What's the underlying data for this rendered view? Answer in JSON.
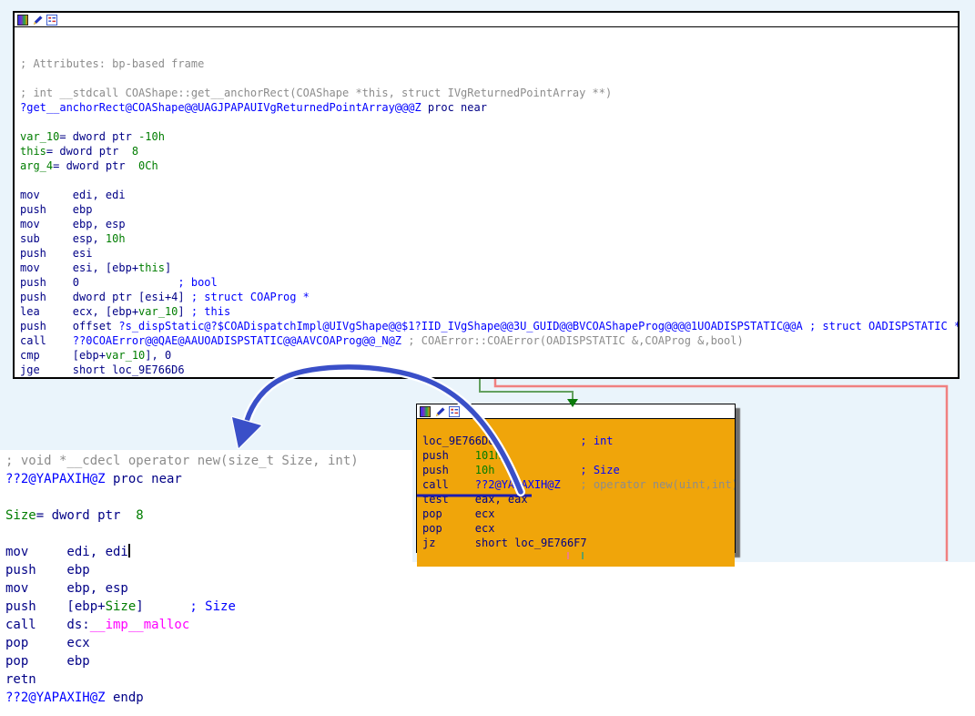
{
  "app": "IDA Pro graph view",
  "colors": {
    "background": "#eaf4fb",
    "node_bg": "#ffffff",
    "node_border": "#000000",
    "highlight_node_bg": "#f0a50a",
    "edge_true": "#63a05f",
    "edge_false": "#f08080",
    "edge_arrowhead": "#0a7a0a",
    "annotation_arrow": "#3a4fc8",
    "annotation_outline": "#ffffff",
    "call_underline": "#1c1cb0",
    "text_default": "#000086",
    "text_name": "#0000ff",
    "text_number": "#007d00",
    "text_comment": "#8c8c8c",
    "text_import": "#ff00ff"
  },
  "title_icons": [
    "palette-icon",
    "edit-icon",
    "graph-overview-icon"
  ],
  "blocks": {
    "main": {
      "lines": [
        [],
        [],
        [
          [
            "; Attributes: bp-based frame",
            "gry"
          ]
        ],
        [],
        [
          [
            "; int __stdcall COAShape::get__anchorRect(COAShape *this, struct IVgReturnedPointArray **)",
            "gry"
          ]
        ],
        [
          [
            "?get__anchorRect@COAShape@@UAGJPAPAUIVgReturnedPointArray@@@Z",
            "blu"
          ],
          [
            " proc near",
            "nav"
          ]
        ],
        [],
        [
          [
            "var_10",
            "grn"
          ],
          [
            "= dword ptr ",
            "nav"
          ],
          [
            "-10h",
            "grn"
          ]
        ],
        [
          [
            "this",
            "grn"
          ],
          [
            "= dword ptr  ",
            "nav"
          ],
          [
            "8",
            "grn"
          ]
        ],
        [
          [
            "arg_4",
            "grn"
          ],
          [
            "= dword ptr  ",
            "nav"
          ],
          [
            "0Ch",
            "grn"
          ]
        ],
        [],
        [
          [
            "mov     edi, edi",
            "nav"
          ]
        ],
        [
          [
            "push    ebp",
            "nav"
          ]
        ],
        [
          [
            "mov     ebp, esp",
            "nav"
          ]
        ],
        [
          [
            "sub     esp, ",
            "nav"
          ],
          [
            "10h",
            "grn"
          ]
        ],
        [
          [
            "push    esi",
            "nav"
          ]
        ],
        [
          [
            "mov     esi, [ebp+",
            "nav"
          ],
          [
            "this",
            "grn"
          ],
          [
            "]",
            "nav"
          ]
        ],
        [
          [
            "push    0               ",
            "nav"
          ],
          [
            "; bool",
            "blu"
          ]
        ],
        [
          [
            "push    dword ptr [esi+4] ",
            "nav"
          ],
          [
            "; struct COAProg *",
            "blu"
          ]
        ],
        [
          [
            "lea     ecx, [ebp+",
            "nav"
          ],
          [
            "var_10",
            "grn"
          ],
          [
            "] ",
            "nav"
          ],
          [
            "; this",
            "blu"
          ]
        ],
        [
          [
            "push    offset ",
            "nav"
          ],
          [
            "?s_dispStatic@?$COADispatchImpl@UIVgShape@@$1?IID_IVgShape@@3U_GUID@@BVCOAShapeProg@@@@1UOADISPSTATIC@@A",
            "blu"
          ],
          [
            " ",
            "nav"
          ],
          [
            "; struct OADISPSTATIC *",
            "blu"
          ]
        ],
        [
          [
            "call    ",
            "nav"
          ],
          [
            "??0COAError@@QAE@AAUOADISPSTATIC@@AAVCOAProg@@_N@Z",
            "blu"
          ],
          [
            " ",
            "nav"
          ],
          [
            "; COAError::COAError(OADISPSTATIC &,COAProg &,bool)",
            "gry"
          ]
        ],
        [
          [
            "cmp     [ebp+",
            "nav"
          ],
          [
            "var_10",
            "grn"
          ],
          [
            "], 0",
            "nav"
          ]
        ],
        [
          [
            "jge     short loc_9E766D6",
            "nav"
          ]
        ]
      ]
    },
    "highlight": {
      "lines": [
        [],
        [
          [
            "loc_9E766D6:            ",
            "nav"
          ],
          [
            "; int",
            "blu"
          ]
        ],
        [
          [
            "push    ",
            "nav"
          ],
          [
            "101h",
            "grn"
          ]
        ],
        [
          [
            "push    ",
            "nav"
          ],
          [
            "10h",
            "grn"
          ],
          [
            "             ",
            "nav"
          ],
          [
            "; Size",
            "blu"
          ]
        ],
        [
          [
            "call    ",
            "nav"
          ],
          [
            "??2@YAPAXIH@Z",
            "blu"
          ],
          [
            "   ",
            "nav"
          ],
          [
            "; operator new(uint,int)",
            "gry"
          ]
        ],
        [
          [
            "test    eax, eax",
            "nav"
          ]
        ],
        [
          [
            "pop     ecx",
            "nav"
          ]
        ],
        [
          [
            "pop     ecx",
            "nav"
          ]
        ],
        [
          [
            "jz      short loc_9E766F7",
            "nav"
          ]
        ]
      ]
    },
    "zoomed": {
      "lines": [
        [
          [
            "; void *__cdecl operator new(size_t Size, int)",
            "gry"
          ]
        ],
        [
          [
            "??2@YAPAXIH@Z",
            "blu"
          ],
          [
            " proc near",
            "nav"
          ]
        ],
        [],
        [
          [
            "Size",
            "grn"
          ],
          [
            "= dword ptr  ",
            "nav"
          ],
          [
            "8",
            "grn"
          ]
        ],
        [],
        [
          [
            "mov     edi, edi",
            "nav"
          ],
          [
            "",
            "cur"
          ]
        ],
        [
          [
            "push    ebp",
            "nav"
          ]
        ],
        [
          [
            "mov     ebp, esp",
            "nav"
          ]
        ],
        [
          [
            "push    [ebp+",
            "nav"
          ],
          [
            "Size",
            "grn"
          ],
          [
            "]      ",
            "nav"
          ],
          [
            "; Size",
            "blu"
          ]
        ],
        [
          [
            "call    ds:",
            "nav"
          ],
          [
            "__imp__malloc",
            "mag"
          ]
        ],
        [
          [
            "pop     ecx",
            "nav"
          ]
        ],
        [
          [
            "pop     ebp",
            "nav"
          ]
        ],
        [
          [
            "retn",
            "nav"
          ]
        ],
        [
          [
            "??2@YAPAXIH@Z",
            "blu"
          ],
          [
            " endp",
            "nav"
          ]
        ]
      ]
    }
  }
}
